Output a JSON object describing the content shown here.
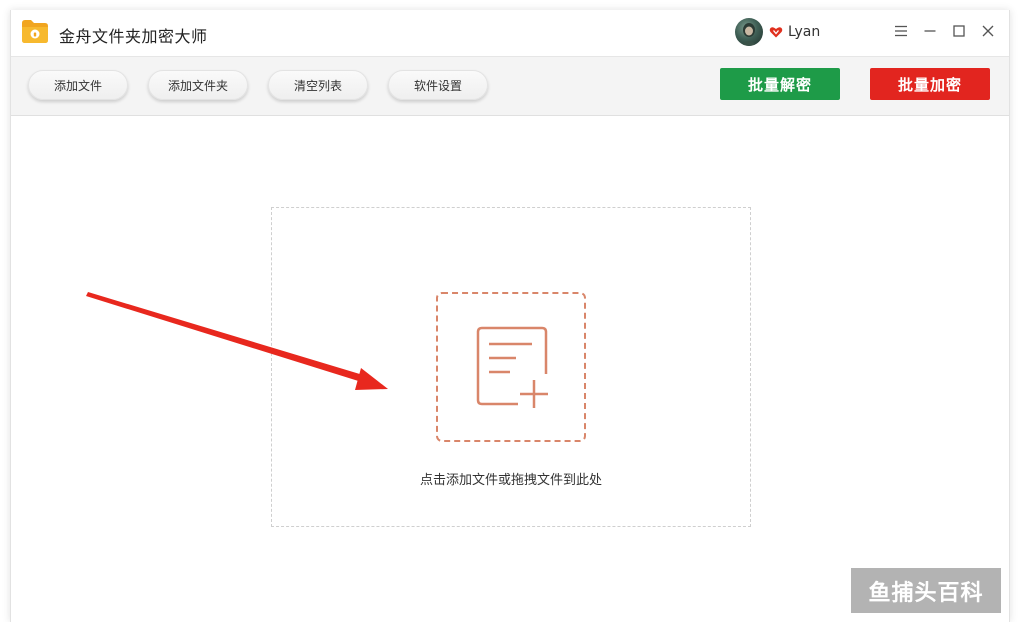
{
  "app": {
    "title": "金舟文件夹加密大师"
  },
  "user": {
    "name": "Lyan",
    "vip_icon": "vip-heart-icon"
  },
  "window_controls": {
    "menu_icon": "menu-icon",
    "minimize_icon": "minimize-icon",
    "maximize_icon": "maximize-icon",
    "close_icon": "close-icon"
  },
  "toolbar": {
    "add_file": "添加文件",
    "add_folder": "添加文件夹",
    "clear_list": "清空列表",
    "settings": "软件设置",
    "batch_decrypt": "批量解密",
    "batch_encrypt": "批量加密"
  },
  "drop_zone": {
    "hint": "点击添加文件或拖拽文件到此处",
    "icon": "add-file-icon"
  },
  "watermark": {
    "text": "鱼捕头百科"
  },
  "colors": {
    "decrypt_button": "#1e9b48",
    "encrypt_button": "#e2251f",
    "accent_orange": "#d9866a",
    "annotation_arrow": "#e8281e"
  }
}
